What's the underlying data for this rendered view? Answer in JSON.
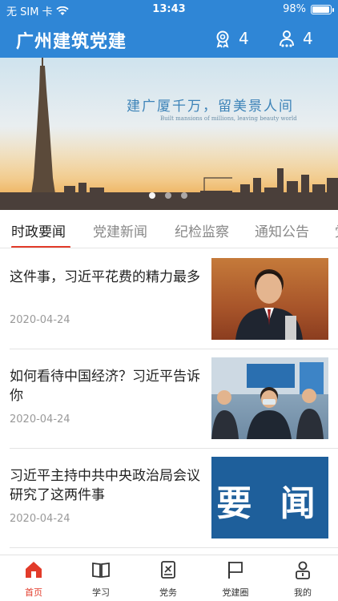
{
  "status": {
    "carrier": "无 SIM 卡",
    "time": "13:43",
    "battery": "98%",
    "battery_level": 0.98
  },
  "header": {
    "title": "广州建筑党建",
    "medal_count": "4",
    "users_count": "4"
  },
  "banner": {
    "slogan": "建广厦千万，留美景人间",
    "slogan_en": "Built mansions of millions, leaving beauty world",
    "slide_count": 3,
    "active_slide": 1
  },
  "tabs": [
    "时政要闻",
    "党建新闻",
    "纪检监察",
    "通知公告",
    "党"
  ],
  "active_tab": 0,
  "news": [
    {
      "headline": "这件事，习近平花费的精力最多",
      "date": "2020-04-24"
    },
    {
      "headline": "如何看待中国经济？习近平告诉你",
      "date": "2020-04-24"
    },
    {
      "headline": "习近平主持中共中央政治局会议 研究了这两件事",
      "date": "2020-04-24",
      "thumb_text": "要 闻"
    }
  ],
  "nav": [
    {
      "label": "首页",
      "icon": "home-icon"
    },
    {
      "label": "学习",
      "icon": "book-icon"
    },
    {
      "label": "党务",
      "icon": "party-affairs-icon"
    },
    {
      "label": "党建圈",
      "icon": "flag-icon"
    },
    {
      "label": "我的",
      "icon": "profile-icon"
    }
  ],
  "colors": {
    "brand_blue": "#2f86d6",
    "accent_red": "#e23b2a"
  }
}
